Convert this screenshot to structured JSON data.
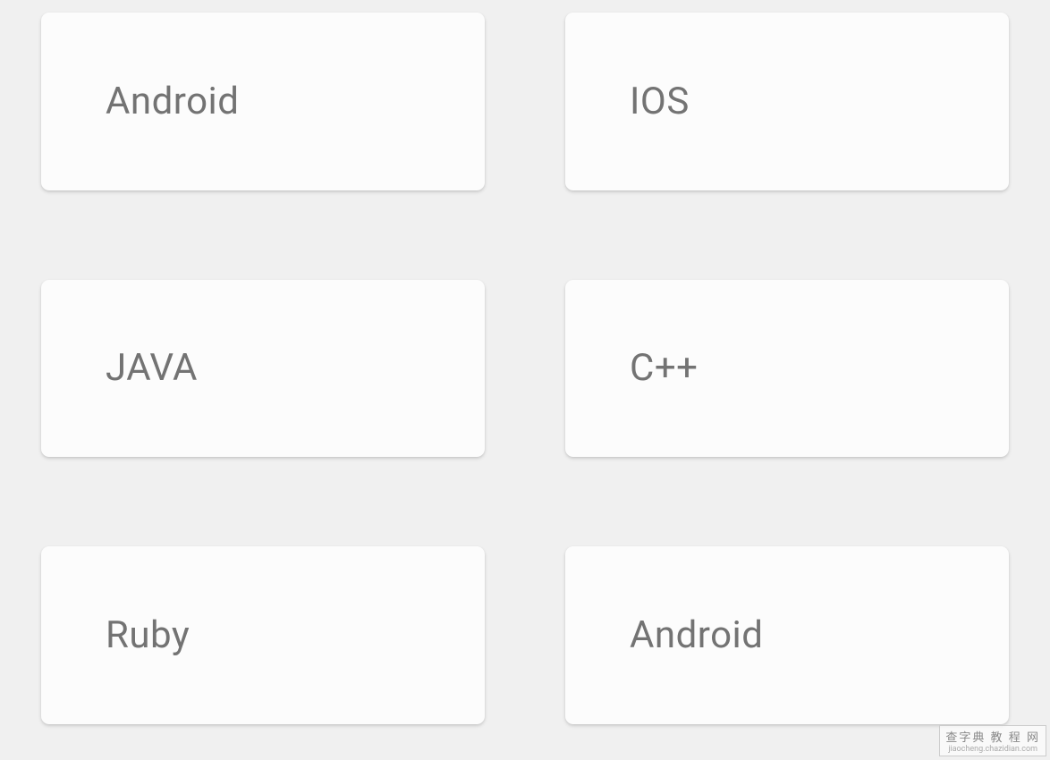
{
  "cards": [
    {
      "label": "Android"
    },
    {
      "label": "IOS"
    },
    {
      "label": "JAVA"
    },
    {
      "label": "C++"
    },
    {
      "label": "Ruby"
    },
    {
      "label": "Android"
    }
  ],
  "watermark": {
    "main": "查字典 教 程 网",
    "sub": "jiaocheng.chazidian.com"
  }
}
